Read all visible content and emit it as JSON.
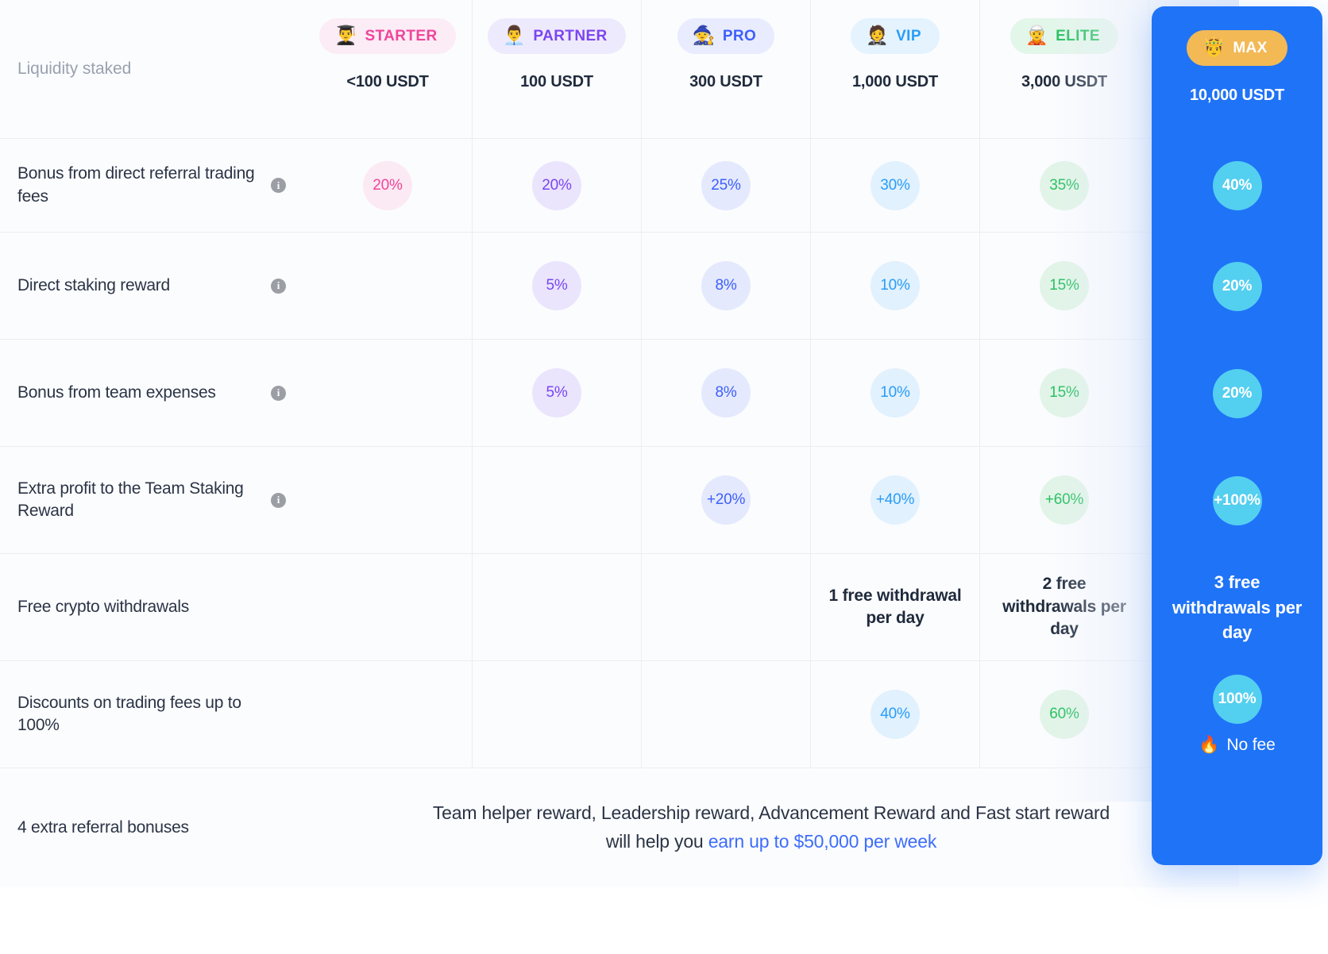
{
  "table": {
    "liquidity_label": "Liquidity staked",
    "tiers": [
      {
        "id": "starter",
        "name": "STARTER",
        "emoji": "👨‍🎓",
        "emoji_name": "man-student-emoji",
        "stake": "<100 USDT",
        "badge_bg": "#fcecf5",
        "badge_color": "#f0449b",
        "bubble_bg": "#fbeaf3",
        "bubble_color": "#f0449b"
      },
      {
        "id": "partner",
        "name": "PARTNER",
        "emoji": "👨‍💼",
        "emoji_name": "man-office-worker-emoji",
        "stake": "100 USDT",
        "badge_bg": "#eeeafd",
        "badge_color": "#7b45f2",
        "bubble_bg": "#eae5fd",
        "bubble_color": "#7b45f2"
      },
      {
        "id": "pro",
        "name": "PRO",
        "emoji": "🧙",
        "emoji_name": "mage-emoji",
        "stake": "300 USDT",
        "badge_bg": "#e9ecfe",
        "badge_color": "#3d5ffb",
        "bubble_bg": "#e4e9fd",
        "bubble_color": "#3d5ffb"
      },
      {
        "id": "vip",
        "name": "VIP",
        "emoji": "🤵",
        "emoji_name": "person-in-tuxedo-emoji",
        "stake": "1,000 USDT",
        "badge_bg": "#e4f3fe",
        "badge_color": "#2a9cf7",
        "bubble_bg": "#e1f1fd",
        "bubble_color": "#2a9cf7"
      },
      {
        "id": "elite",
        "name": "ELITE",
        "emoji": "🧝",
        "emoji_name": "elf-emoji",
        "stake": "3,000 USDT",
        "badge_bg": "#e3f6ea",
        "badge_color": "#22bf5c",
        "bubble_bg": "#e1f4e7",
        "bubble_color": "#22bf5c"
      }
    ],
    "max_tier": {
      "id": "max",
      "name": "MAX",
      "emoji": "🤴",
      "emoji_name": "prince-emoji",
      "stake": "10,000 USDT",
      "badge_bg": "#f2b955",
      "card_bg": "#1f73f7",
      "bubble_bg": "#53cff0"
    },
    "rows": [
      {
        "id": "referral-trading-fees",
        "label": "Bonus from direct referral trading fees",
        "has_info": true,
        "type": "bubble",
        "values": [
          "20%",
          "20%",
          "25%",
          "30%",
          "35%"
        ],
        "max_value": "40%"
      },
      {
        "id": "direct-staking-reward",
        "label": "Direct staking reward",
        "has_info": true,
        "type": "bubble",
        "values": [
          "",
          "5%",
          "8%",
          "10%",
          "15%"
        ],
        "max_value": "20%"
      },
      {
        "id": "team-expenses-bonus",
        "label": "Bonus from team expenses",
        "has_info": true,
        "type": "bubble",
        "values": [
          "",
          "5%",
          "8%",
          "10%",
          "15%"
        ],
        "max_value": "20%"
      },
      {
        "id": "extra-profit-team-staking",
        "label": "Extra profit to the Team Staking Reward",
        "has_info": true,
        "type": "bubble",
        "values": [
          "",
          "",
          "+20%",
          "+40%",
          "+60%"
        ],
        "max_value": "+100%"
      },
      {
        "id": "free-crypto-withdrawals",
        "label": "Free crypto withdrawals",
        "has_info": false,
        "type": "text",
        "values": [
          "",
          "",
          "",
          "1 free withdrawal per day",
          "2 free withdrawals per day"
        ],
        "max_value": "3 free withdrawals per day"
      },
      {
        "id": "trading-fee-discounts",
        "label": "Discounts on trading fees up to 100%",
        "has_info": false,
        "type": "bubble",
        "values": [
          "",
          "",
          "",
          "40%",
          "60%"
        ],
        "max_value": "100%",
        "max_footnote": "No fee",
        "max_footnote_emoji": "🔥",
        "max_footnote_emoji_name": "fire-emoji"
      }
    ],
    "footer": {
      "label": "4 extra referral bonuses",
      "line1": "Team helper reward, Leadership reward, Advancement Reward and Fast start reward",
      "line2_prefix": "will help you ",
      "line2_link": "earn up to $50,000 per week",
      "link_color": "#3d6dfb"
    }
  }
}
